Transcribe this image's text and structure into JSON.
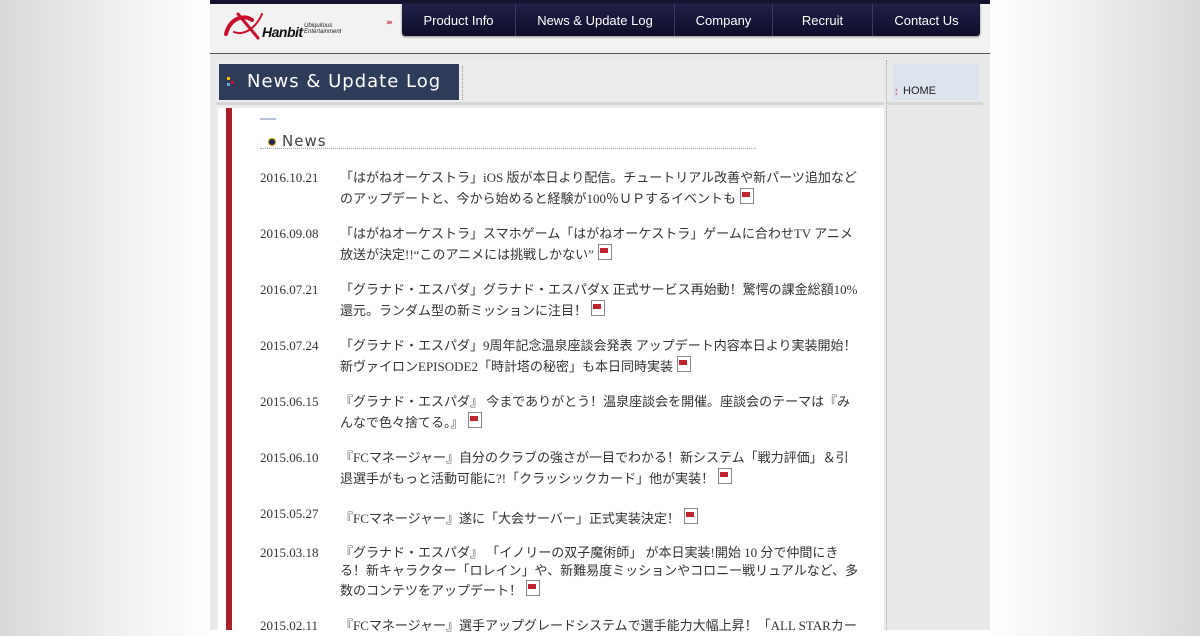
{
  "brand": {
    "name": "Hanbit",
    "tagline": "Ubiquitous Entertainment"
  },
  "nav": [
    {
      "label": "Product Info"
    },
    {
      "label": "News & Update Log"
    },
    {
      "label": "Company"
    },
    {
      "label": "Recruit"
    },
    {
      "label": "Contact Us"
    }
  ],
  "page_title": "News & Update Log",
  "section_title": "News",
  "sidebar": {
    "home": "HOME"
  },
  "colors": {
    "nav_bg": "#13132f",
    "accent_red": "#a81f2a",
    "title_bg": "#2e3c5a"
  },
  "news": [
    {
      "date": "2016.10.21",
      "text": "「はがねオーケストラ」iOS 版が本日より配信。チュートリアル改善や新パーツ追加などのアップデートと、今から始めると経験が100％ＵＰするイベントも",
      "icon": "pdf-icon"
    },
    {
      "date": "2016.09.08",
      "text": "「はがねオーケストラ」スマホゲーム「はがねオーケストラ」ゲームに合わせTV アニメ放送が決定!!“このアニメには挑戦しかない”",
      "icon": "pdf-icon"
    },
    {
      "date": "2016.07.21",
      "text": "「グラナド・エスパダ」グラナド・エスパダX 正式サービス再始動！驚愕の課金総額10%還元。ランダム型の新ミッションに注目！",
      "icon": "pdf-icon"
    },
    {
      "date": "2015.07.24",
      "text": "「グラナド・エスパダ」9周年記念温泉座談会発表 アップデート内容本日より実装開始！新ヴァイロンEPISODE2「時計塔の秘密」も本日同時実装",
      "icon": "pdf-icon"
    },
    {
      "date": "2015.06.15",
      "text": "『グラナド・エスパダ』 今までありがとう！温泉座談会を開催。座談会のテーマは『みんなで色々捨てる。』",
      "icon": "pdf-icon"
    },
    {
      "date": "2015.06.10",
      "text": "『FCマネージャー』自分のクラブの強さが一目でわかる！新システム「戦力評価」＆引退選手がもっと活動可能に?!「クラッシックカード」他が実装！",
      "icon": "pdf-icon"
    },
    {
      "date": "2015.05.27",
      "text": "『FCマネージャー』遂に「大会サーバー」正式実装決定！",
      "icon": "pdf-icon"
    },
    {
      "date": "2015.03.18",
      "text": "『グラナド・エスパダ』 「イノリーの双子魔術師」 が本日実装!開始 10 分で仲間にきる！新キャラクター「ロレイン」や、新難易度ミッションやコロニー戦リュアルなど、多数のコンテツをアップデート！",
      "icon": "pdf-icon"
    },
    {
      "date": "2015.02.11",
      "text": "『FCマネージャー』選手アップグレードシステムで選手能力大幅上昇！「ALL STARカー",
      "icon": ""
    }
  ]
}
